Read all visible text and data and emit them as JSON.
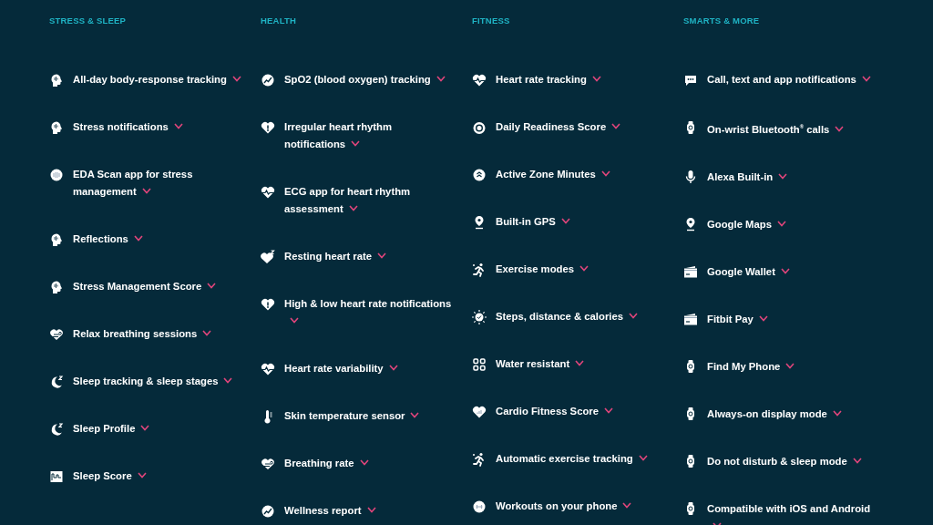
{
  "columns": [
    {
      "heading": "STRESS & SLEEP",
      "items": [
        {
          "label": "All-day body-response tracking",
          "expanded": false
        },
        {
          "label": "Stress notifications",
          "expanded": false
        },
        {
          "label": "EDA Scan app for stress management",
          "expanded": false
        },
        {
          "label": "Reflections",
          "expanded": false
        },
        {
          "label": "Stress Management Score",
          "expanded": false
        },
        {
          "label": "Relax breathing sessions",
          "expanded": false
        },
        {
          "label": "Sleep tracking & sleep stages",
          "expanded": false
        },
        {
          "label": "Sleep Profile",
          "expanded": false
        },
        {
          "label": "Sleep Score",
          "expanded": false
        }
      ]
    },
    {
      "heading": "HEALTH",
      "items": [
        {
          "label": "SpO2 (blood oxygen) tracking",
          "expanded": false
        },
        {
          "label": "Irregular heart rhythm notifications",
          "expanded": false
        },
        {
          "label": "ECG app for heart rhythm assessment",
          "expanded": false
        },
        {
          "label": "Resting heart rate",
          "expanded": false
        },
        {
          "label": "High & low heart rate notifications",
          "expanded": false
        },
        {
          "label": "Heart rate variability",
          "expanded": false
        },
        {
          "label": "Skin temperature sensor",
          "expanded": false
        },
        {
          "label": "Breathing rate",
          "expanded": false
        },
        {
          "label": "Wellness report",
          "expanded": false
        }
      ]
    },
    {
      "heading": "FITNESS",
      "items": [
        {
          "label": "Heart rate tracking",
          "expanded": false
        },
        {
          "label": "Daily Readiness Score",
          "expanded": false
        },
        {
          "label": "Active Zone Minutes",
          "expanded": false
        },
        {
          "label": "Built-in GPS",
          "expanded": false
        },
        {
          "label": "Exercise modes",
          "expanded": false
        },
        {
          "label": "Steps, distance & calories",
          "expanded": false
        },
        {
          "label": "Water resistant",
          "expanded": false
        },
        {
          "label": "Cardio Fitness Score",
          "expanded": false
        },
        {
          "label": "Automatic exercise tracking",
          "expanded": false
        },
        {
          "label": "Workouts on your phone",
          "expanded": false
        }
      ]
    },
    {
      "heading": "SMARTS & MORE",
      "items": [
        {
          "label": "Call, text and app notifications",
          "expanded": false
        },
        {
          "label": "On-wrist Bluetooth$^{®}$ calls",
          "expanded": false
        },
        {
          "label": "Alexa Built-in",
          "expanded": false
        },
        {
          "label": "Google Maps",
          "expanded": false
        },
        {
          "label": "Google Wallet",
          "expanded": false
        },
        {
          "label": "Fitbit Pay",
          "expanded": false
        },
        {
          "label": "Find My Phone",
          "expanded": false
        },
        {
          "label": "Always-on display mode",
          "expanded": false
        },
        {
          "label": "Do not disturb & sleep mode",
          "expanded": false
        },
        {
          "label": "Compatible with iOS and Android",
          "expanded": false
        }
      ]
    }
  ]
}
